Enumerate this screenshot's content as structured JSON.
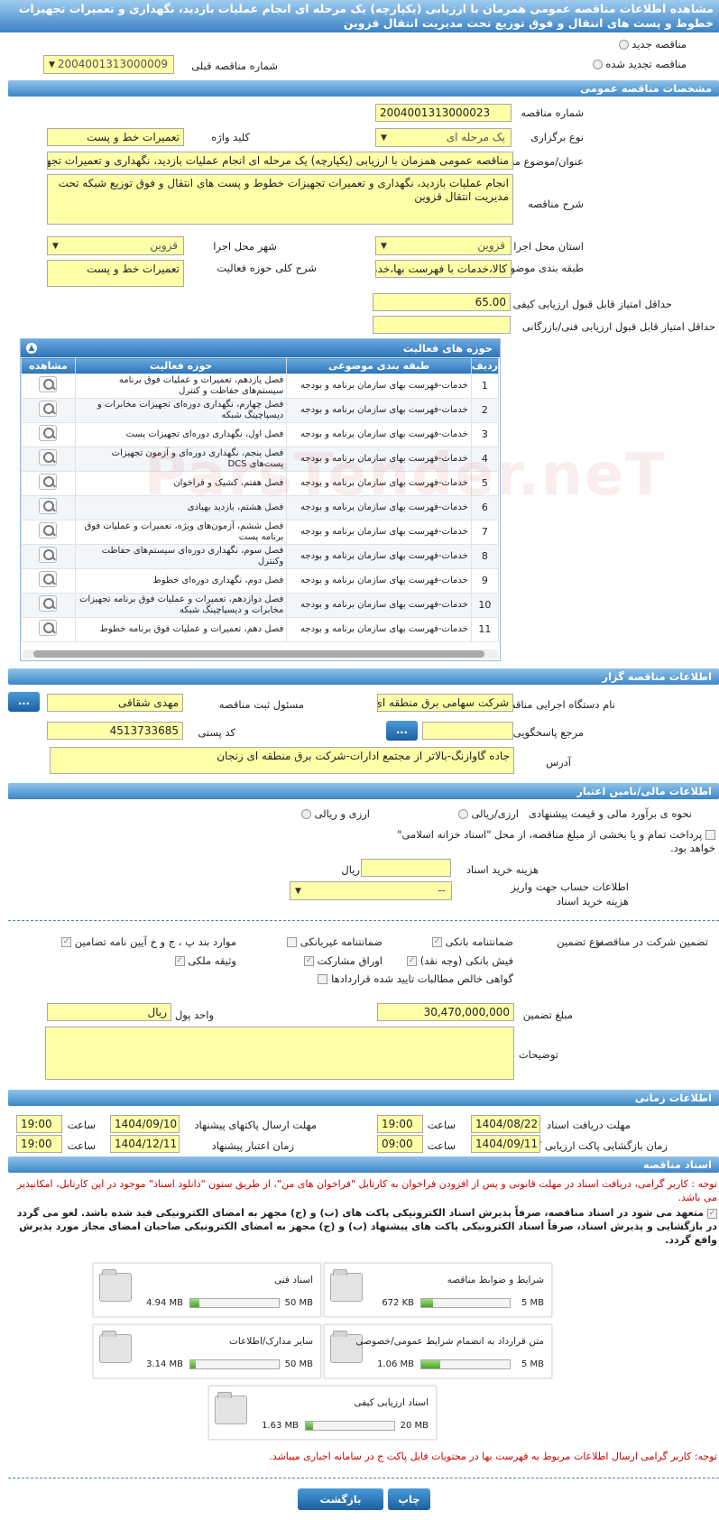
{
  "page_title": "مشاهده اطلاعات مناقصه عمومی همزمان با ارزیابی (یکپارچه) یک مرحله ای انجام عملیات بازدید، نگهداری و تعمیرات تجهیزات خطوط و پست های انتقال و فوق توزیع تحت مدیریت انتقال قزوین",
  "top": {
    "new_tender": "مناقصه جدید",
    "renewed_tender": "مناقصه تجدید شده",
    "prev_number_label": "شماره مناقصه قبلی",
    "prev_number": "2004001313000009"
  },
  "general": {
    "header": "مشخصات مناقصه عمومی",
    "number_label": "شماره مناقصه",
    "number": "2004001313000023",
    "type_label": "نوع برگزاری",
    "type": "یک مرحله ای",
    "keyword_label": "کلید واژه",
    "keyword": "تعمیرات خط و پست",
    "title_label": "عنوان/موضوع مناقصه",
    "title": "مناقصه عمومی همزمان با ارزیابی (یکپارچه) یک مرحله ای انجام عملیات بازدید، نگهداری و تعمیرات تجهیزات خطوط و پست های انتقال",
    "desc_label": "شرح مناقصه",
    "desc": "انجام عملیات بازدید، نگهداری و تعمیرات تجهیزات خطوط و پست های انتقال و فوق توزیع شبکه تحت مدیریت انتقال قزوین",
    "province_label": "استان محل اجرا",
    "province": "قزوین",
    "city_label": "شهر محل اجرا",
    "city": "قزوین",
    "category_label": "طبقه بندی موضوعی",
    "category": "کالا،خدمات با فهرست بها،خدمات",
    "activity_desc_label": "شرح کلی حوزه فعالیت",
    "activity_desc": "تعمیرات خط و پست",
    "min_quality_label": "حداقل امتیاز قابل قبول ارزیابی کیفی",
    "min_quality": "65.00",
    "min_tech_label": "حداقل امتیاز قابل قبول ارزیابی فنی/بازرگانی",
    "min_tech": ""
  },
  "activities": {
    "header": "حوزه های فعالیت",
    "columns": [
      "ردیف",
      "طبقه بندی موضوعی",
      "حوزه فعالیت",
      "مشاهده"
    ],
    "rows": [
      {
        "n": "1",
        "cat": "خدمات-فهرست بهای سازمان برنامه و بودجه",
        "area": "فصل یازدهم، تعمیرات و عملیات فوق برنامه سیستم‌های حفاظت و کنترل"
      },
      {
        "n": "2",
        "cat": "خدمات-فهرست بهای سازمان برنامه و بودجه",
        "area": "فصل چهارم، نگهداری دوره‌ای تجهیزات مخابرات و دیسپاچینگ شبکه"
      },
      {
        "n": "3",
        "cat": "خدمات-فهرست بهای سازمان برنامه و بودجه",
        "area": "فصل اول، نگهداری دوره‌ای تجهیزات پست"
      },
      {
        "n": "4",
        "cat": "خدمات-فهرست بهای سازمان برنامه و بودجه",
        "area": "فصل پنجم، نگهداری دوره‌ای و آزمون تجهیزات پست‌های DCS"
      },
      {
        "n": "5",
        "cat": "خدمات-فهرست بهای سازمان برنامه و بودجه",
        "area": "فصل هفتم، کشیک و فراخوان"
      },
      {
        "n": "6",
        "cat": "خدمات-فهرست بهای سازمان برنامه و بودجه",
        "area": "فصل هشتم، بازدید بهیادی"
      },
      {
        "n": "7",
        "cat": "خدمات-فهرست بهای سازمان برنامه و بودجه",
        "area": "فصل ششم، آزمون‌های ویژه، تعمیرات و عملیات فوق برنامه پست"
      },
      {
        "n": "8",
        "cat": "خدمات-فهرست بهای سازمان برنامه و بودجه",
        "area": "فصل سوم، نگهداری دوره‌ای سیستم‌های حفاظت وکنترل"
      },
      {
        "n": "9",
        "cat": "خدمات-فهرست بهای سازمان برنامه و بودجه",
        "area": "فصل دوم، نگهداری دوره‌ای خطوط"
      },
      {
        "n": "10",
        "cat": "خدمات-فهرست بهای سازمان برنامه و بودجه",
        "area": "فصل دوازدهم، تعمیرات و عملیات فوق برنامه تجهیزات مخابرات و دیسپاچینگ شبکه"
      },
      {
        "n": "11",
        "cat": "خدمات-فهرست بهای سازمان برنامه و بودجه",
        "area": "فصل دهم، تعمیرات و عملیات فوق برنامه خطوط"
      }
    ]
  },
  "organizer": {
    "header": "اطلاعات مناقصه گزار",
    "org_label": "نام دستگاه اجرایی مناقصه گزار",
    "org": "شرکت سهامی برق منطقه ای زنجان",
    "responsible_label": "مسئول ثبت مناقصه",
    "responsible": "مهدی شقاقی",
    "ref_label": "مرجع پاسخگویی",
    "ref": "",
    "postal_label": "کد پستی",
    "postal": "4513733685",
    "address_label": "آدرس",
    "address": "جاده گاوازنگ-بالاتر از مجتمع ادارات-شرکت برق منطقه ای زنجان",
    "btn": "..."
  },
  "financial": {
    "header": "اطلاعات مالی/تامین اعتبار",
    "estimate_label": "نحوه ی برآورد مالی و قیمت پیشنهادی",
    "opt1": "ارزی/ریالی",
    "opt2": "ارزی و ریالی",
    "treasury_text": "پرداخت تمام و یا بخشی از مبلغ مناقصه، از محل \"اسناد خزانه اسلامی\" خواهد بود.",
    "doc_cost_label": "هزینه خرید اسناد",
    "doc_cost": "",
    "doc_cost_unit": "ریال",
    "account_label": "اطلاعات حساب جهت واریز هزینه خرید اسناد",
    "account": "--"
  },
  "guarantee": {
    "label": "تضمین شرکت در مناقصه:",
    "type_label": "نوع تضمین",
    "items": [
      "ضمانتنامه بانکی",
      "ضمانتنامه غیربانکی",
      "موارد بند پ ، ج و خ آیین نامه تضامین",
      "فیش بانکی (وجه نقد)",
      "اوراق مشارکت",
      "وثیقه ملکی",
      "گواهی خالص مطالبات تایید شده قراردادها"
    ],
    "amount_label": "مبلغ تضمین",
    "amount": "30,470,000,000",
    "currency_label": "واحد پول",
    "currency": "ریال",
    "notes_label": "توضیحات",
    "notes": ""
  },
  "timing": {
    "header": "اطلاعات زمانی",
    "receive_label": "مهلت دریافت اسناد",
    "receive_date": "1404/08/22",
    "receive_time": "19:00",
    "send_label": "مهلت ارسال پاکتهای پیشنهاد",
    "send_date": "1404/09/10",
    "send_time": "19:00",
    "open_label": "زمان بازگشایی پاکت ارزیابی کیفی",
    "open_date": "1404/09/11",
    "open_time": "09:00",
    "valid_label": "زمان اعتبار پیشنهاد",
    "valid_date": "1404/12/11",
    "valid_time": "19:00",
    "time_label": "ساعت"
  },
  "docs": {
    "header": "اسناد مناقصه",
    "note1": "توجه : کاربر گرامی، دریافت اسناد در مهلت قانونی و پس از افزودن فراخوان به کارتابل \"فراخوان های من\"، از طریق ستون \"دانلود اسناد\" موجود در این کارتابل، امکانپذیر می باشد.",
    "note2": "متعهد می شود در اسناد مناقصه، صرفاً پذیرش اسناد الکترونیکی پاکت های (ب) و (ج) مجهز به امضای الکترونیکی قید شده باشد. لغو می گردد در بازگشایی و پذیرش اسناد، صرفاً اسناد الکترونیکی پاکت های پیشنهاد (ب) و (ج) مجهز به امضای الکترونیکی صاحبان امضای مجاز مورد پذیرش واقع گردد.",
    "files": [
      {
        "name": "شرایط و ضوابط مناقصه",
        "size": "672 KB",
        "max": "5 MB",
        "fill": 0.13
      },
      {
        "name": "اسناد فنی",
        "size": "4.94 MB",
        "max": "50 MB",
        "fill": 0.1
      },
      {
        "name": "متن قرارداد به انضمام شرایط عمومی/خصوصی",
        "size": "1.06 MB",
        "max": "5 MB",
        "fill": 0.21
      },
      {
        "name": "سایر مدارک/اطلاعات",
        "size": "3.14 MB",
        "max": "50 MB",
        "fill": 0.06
      },
      {
        "name": "اسناد ارزیابی کیفی",
        "size": "1.63 MB",
        "max": "20 MB",
        "fill": 0.08
      }
    ],
    "note3": "توجه: کاربر گرامی ارسال اطلاعات مربوط به فهرست بها در محتویات فایل پاکت ج در سامانه اجباری میباشد."
  },
  "buttons": {
    "back": "بازگشت",
    "print": "چاپ"
  },
  "colors": {
    "header": "#3d87c8",
    "field": "#ffffa8",
    "warning": "#d40000"
  }
}
